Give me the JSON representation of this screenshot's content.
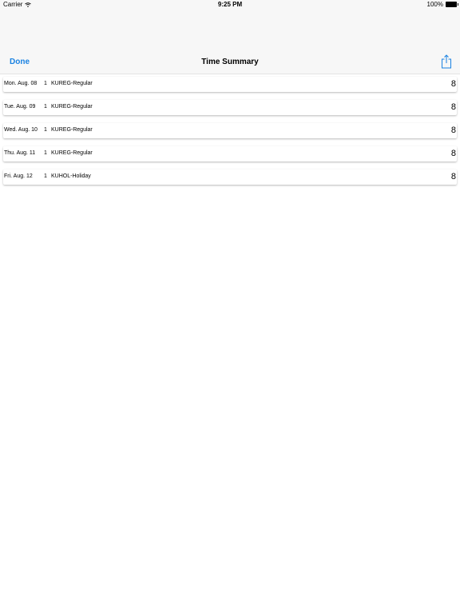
{
  "status_bar": {
    "carrier": "Carrier",
    "time": "9:25 PM",
    "battery": "100%"
  },
  "nav": {
    "done_label": "Done",
    "title": "Time Summary",
    "share_icon": "share-icon",
    "accent_color": "#1a82e2"
  },
  "rows": [
    {
      "date": "Mon. Aug. 08",
      "qty": "1",
      "code": "KUREG-Regular",
      "hours": "8"
    },
    {
      "date": "Tue. Aug. 09",
      "qty": "1",
      "code": "KUREG-Regular",
      "hours": "8"
    },
    {
      "date": "Wed. Aug. 10",
      "qty": "1",
      "code": "KUREG-Regular",
      "hours": "8"
    },
    {
      "date": "Thu. Aug. 11",
      "qty": "1",
      "code": "KUREG-Regular",
      "hours": "8"
    },
    {
      "date": "Fri. Aug. 12",
      "qty": "1",
      "code": "KUHOL-Holiday",
      "hours": "8"
    }
  ]
}
